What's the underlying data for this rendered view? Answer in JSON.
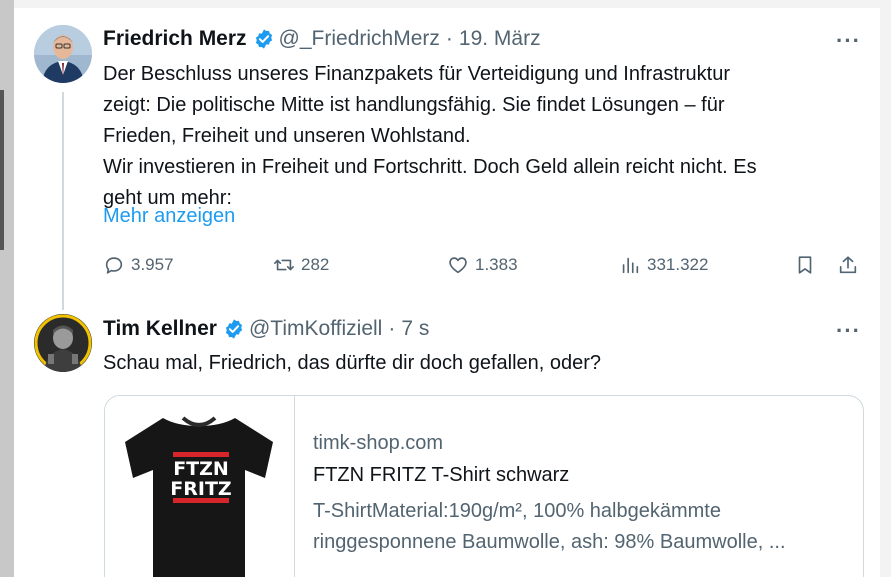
{
  "tweet1": {
    "name": "Friedrich Merz",
    "handle": "@_FriedrichMerz",
    "separator": "·",
    "time": "19. März",
    "more": "···",
    "lines": [
      "Der Beschluss unseres Finanzpakets für Verteidigung und Infrastruktur",
      "zeigt: Die politische Mitte ist handlungsfähig. Sie findet Lösungen – für",
      "Frieden, Freiheit und unseren Wohlstand.",
      "Wir investieren in Freiheit und Fortschritt. Doch Geld allein reicht nicht. Es",
      "geht um mehr:"
    ],
    "show_more": "Mehr anzeigen",
    "actions": {
      "replies": "3.957",
      "reposts": "282",
      "likes": "1.383",
      "views": "331.322"
    }
  },
  "tweet2": {
    "name": "Tim Kellner",
    "handle": "@TimKoffiziell",
    "separator": "·",
    "time": "7 s",
    "more": "···",
    "text": "Schau mal, Friedrich, das dürfte dir doch gefallen, oder?",
    "card": {
      "domain": "timk-shop.com",
      "title": "FTZN FRITZ T-Shirt schwarz",
      "desc_lines": [
        "T-ShirtMaterial:190g/m², 100% halbgekämmte",
        "ringgesponnene Baumwolle, ash: 98% Baumwolle, ..."
      ],
      "shirt_text_line1": "FTZN",
      "shirt_text_line2": "FRITZ"
    }
  },
  "icons": {
    "verified": "verified-badge-icon",
    "reply": "reply-icon",
    "repost": "repost-icon",
    "like": "heart-icon",
    "views": "views-icon",
    "bookmark": "bookmark-icon",
    "share": "share-icon"
  },
  "colors": {
    "accent": "#1d9bf0",
    "secondary_text": "#536471",
    "primary_text": "#0f1419",
    "border": "#cfd9de",
    "shirt_red": "#d6262b"
  }
}
